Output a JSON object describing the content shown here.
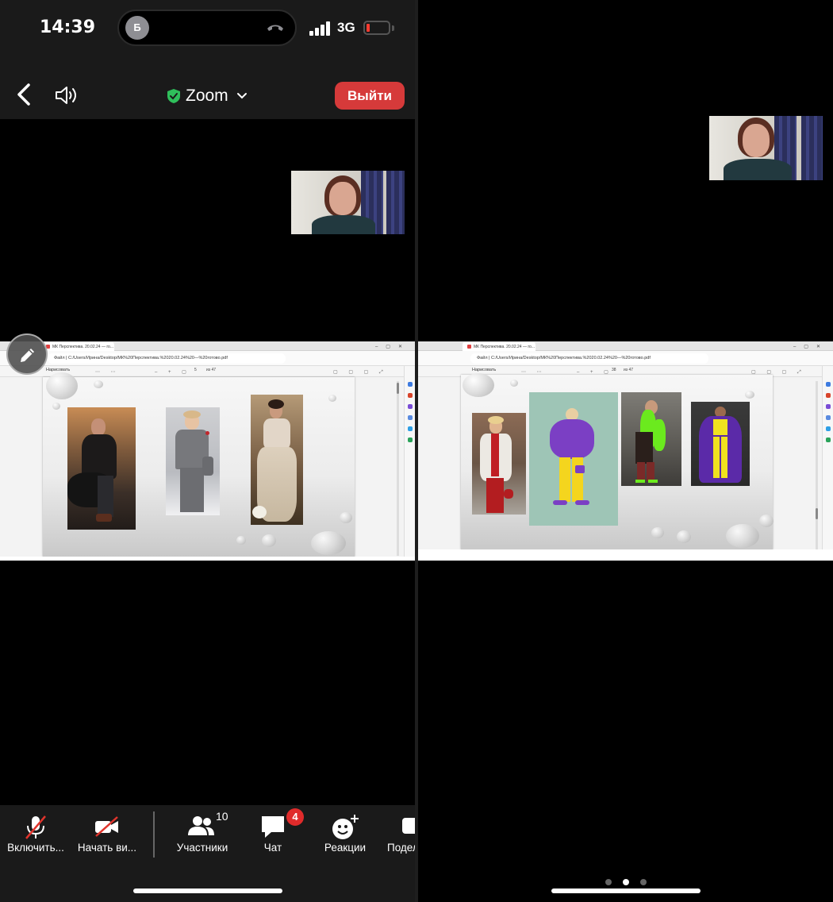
{
  "status_bar": {
    "time": "14:39",
    "caller_initial": "Б",
    "network": "3G",
    "battery_low": true
  },
  "top_bar": {
    "title": "Zoom",
    "leave_label": "Выйти"
  },
  "shared_screen": {
    "left": {
      "tab_title": "МК Перспектива. 20.02.24 — го...",
      "file_label": "Файл",
      "address": "C:/Users/Ирина/Desktop/МК%20Перспектива.%2020.02.24%20—%20готово.pdf",
      "draw_label": "Нарисовать",
      "page_current": "5",
      "page_total": "из 47"
    },
    "right": {
      "tab_title": "МК Перспектива. 20.02.24 — го...",
      "file_label": "Файл",
      "address": "C:/Users/Ирина/Desktop/МК%20Перспектива.%2020.02.24%20—%20готово.pdf",
      "draw_label": "Нарисовать",
      "page_current": "38",
      "page_total": "из 47"
    }
  },
  "bottom_bar": {
    "mute_label": "Включить...",
    "video_label": "Начать ви...",
    "participants_label": "Участники",
    "participants_count": "10",
    "chat_label": "Чат",
    "chat_badge": "4",
    "reactions_label": "Реакции",
    "share_label": "Подел"
  },
  "page_dots": {
    "count": 3,
    "active_index": 1
  },
  "colors": {
    "leave": "#d63a3a",
    "badge": "#e02b2b",
    "shield": "#2fbf5b"
  }
}
